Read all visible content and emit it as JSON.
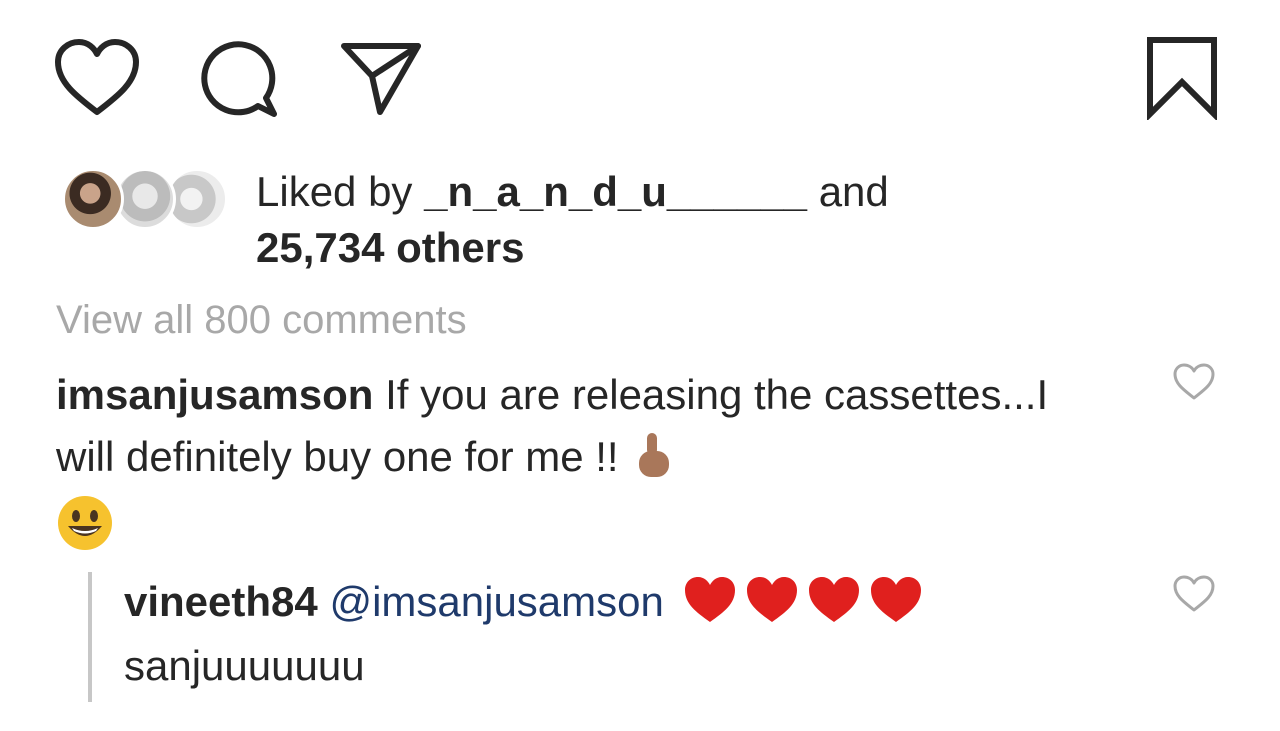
{
  "actions": {
    "like_icon": "heart-outline-icon",
    "comment_icon": "comment-bubble-icon",
    "share_icon": "paper-plane-icon",
    "save_icon": "bookmark-outline-icon"
  },
  "likes": {
    "prefix": "Liked by ",
    "liker": "_n_a_n_d_u______",
    "middle": " and",
    "others": "25,734 others"
  },
  "view_all": "View all 800 comments",
  "comment": {
    "username": "imsanjusamson",
    "text": " If you are releasing the cassettes...I will definitely buy one for me !!",
    "emojis": [
      "pointing-up-icon",
      "smiling-face-icon"
    ]
  },
  "reply": {
    "username": "vineeth84",
    "mention": "@imsanjusamson",
    "hearts": 4,
    "text": "sanjuuuuuuu"
  },
  "colors": {
    "text": "#262626",
    "muted": "#a8a8a8",
    "mention": "#1f3a6b",
    "heart": "#e0201e"
  }
}
